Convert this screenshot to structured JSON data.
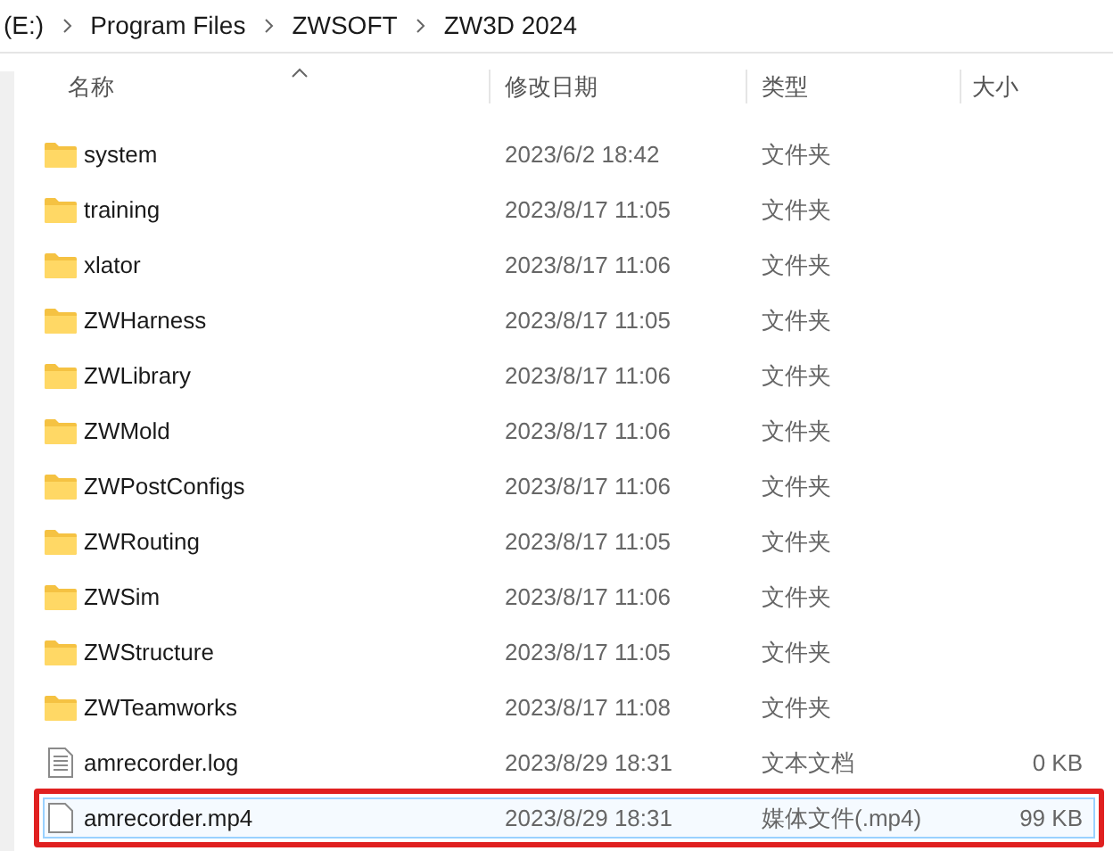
{
  "breadcrumb": [
    "(E:)",
    "Program Files",
    "ZWSOFT",
    "ZW3D 2024"
  ],
  "table": {
    "columns": [
      "名称",
      "修改日期",
      "类型",
      "大小"
    ],
    "rows": [
      {
        "kind": "folder",
        "name": "system",
        "date": "2023/6/2 18:42",
        "type": "文件夹",
        "selected": false,
        "highlighted": false
      },
      {
        "kind": "folder",
        "name": "training",
        "date": "2023/8/17 11:05",
        "type": "文件夹",
        "selected": false,
        "highlighted": false
      },
      {
        "kind": "folder",
        "name": "xlator",
        "date": "2023/8/17 11:06",
        "type": "文件夹",
        "selected": false,
        "highlighted": false
      },
      {
        "kind": "folder",
        "name": "ZWHarness",
        "date": "2023/8/17 11:05",
        "type": "文件夹",
        "selected": false,
        "highlighted": false
      },
      {
        "kind": "folder",
        "name": "ZWLibrary",
        "date": "2023/8/17 11:06",
        "type": "文件夹",
        "selected": false,
        "highlighted": false
      },
      {
        "kind": "folder",
        "name": "ZWMold",
        "date": "2023/8/17 11:06",
        "type": "文件夹",
        "selected": false,
        "highlighted": false
      },
      {
        "kind": "folder",
        "name": "ZWPostConfigs",
        "date": "2023/8/17 11:06",
        "type": "文件夹",
        "selected": false,
        "highlighted": false
      },
      {
        "kind": "folder",
        "name": "ZWRouting",
        "date": "2023/8/17 11:05",
        "type": "文件夹",
        "selected": false,
        "highlighted": false
      },
      {
        "kind": "folder",
        "name": "ZWSim",
        "date": "2023/8/17 11:06",
        "type": "文件夹",
        "selected": false,
        "highlighted": false
      },
      {
        "kind": "folder",
        "name": "ZWStructure",
        "date": "2023/8/17 11:05",
        "type": "文件夹",
        "selected": false,
        "highlighted": false
      },
      {
        "kind": "folder",
        "name": "ZWTeamworks",
        "date": "2023/8/17 11:08",
        "type": "文件夹",
        "selected": false,
        "highlighted": false
      },
      {
        "kind": "text",
        "name": "amrecorder.log",
        "date": "2023/8/29 18:31",
        "type": "文本文档",
        "size": "0 KB",
        "selected": false,
        "highlighted": false
      },
      {
        "kind": "file",
        "name": "amrecorder.mp4",
        "date": "2023/8/29 18:31",
        "type": "媒体文件(.mp4)",
        "size": "99 KB",
        "selected": true,
        "highlighted": true
      }
    ]
  }
}
